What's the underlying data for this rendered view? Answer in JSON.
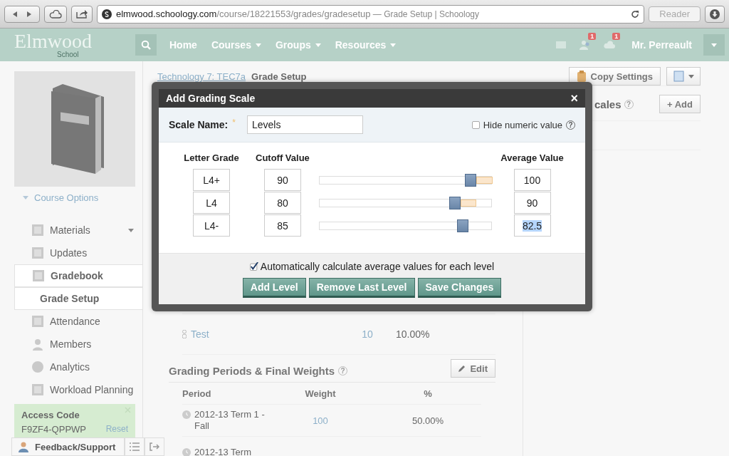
{
  "browser": {
    "url_host": "elmwood.schoology.com",
    "url_path": "/course/18221553/grades/gradesetup",
    "page_title": " — Grade Setup | Schoology",
    "reader": "Reader"
  },
  "nav": {
    "logo": "Elmwood",
    "logo_sub": "School",
    "items": [
      {
        "label": "Home",
        "dropdown": false
      },
      {
        "label": "Courses",
        "dropdown": true
      },
      {
        "label": "Groups",
        "dropdown": true
      },
      {
        "label": "Resources",
        "dropdown": true
      }
    ],
    "badges": [
      "1",
      "1"
    ],
    "user": "Mr. Perreault"
  },
  "sidebar": {
    "course_options": "Course Options",
    "items": [
      {
        "label": "Materials",
        "selected": false,
        "expandable": true
      },
      {
        "label": "Updates",
        "selected": false,
        "expandable": false
      },
      {
        "label": "Gradebook",
        "selected": true,
        "expandable": false,
        "children": [
          {
            "label": "Grade Setup",
            "selected": true
          }
        ]
      },
      {
        "label": "Attendance",
        "selected": false,
        "expandable": false
      },
      {
        "label": "Members",
        "selected": false,
        "expandable": false
      },
      {
        "label": "Analytics",
        "selected": false,
        "expandable": false
      },
      {
        "label": "Workload Planning",
        "selected": false,
        "expandable": false
      }
    ],
    "access_code": {
      "title": "Access Code",
      "code": "F9ZF4-QPPWP",
      "reset": "Reset"
    },
    "feedback": "Feedback/Support"
  },
  "breadcrumb": [
    {
      "label": "Technology 7: TEC7a",
      "link": true
    },
    {
      "label": "Grade Setup",
      "link": false
    }
  ],
  "toolbar": {
    "copy_settings": "Copy Settings"
  },
  "scales_section": {
    "title": "cales",
    "help": "?",
    "add": "+ Add"
  },
  "category_rows": [
    {
      "name": "Test",
      "weight": "10",
      "percent": "10.00%"
    }
  ],
  "grading_periods": {
    "title": "Grading Periods & Final Weights",
    "help": "?",
    "edit": "Edit",
    "columns": [
      "Period",
      "Weight",
      "%"
    ],
    "rows": [
      {
        "period": "2012-13 Term 1 - Fall",
        "weight": "100",
        "percent": "50.00%"
      },
      {
        "period": "2012-13 Term"
      }
    ]
  },
  "modal": {
    "title": "Add Grading Scale",
    "close": "×",
    "scale_name_label": "Scale Name:",
    "required_mark": "*",
    "scale_name": "Levels",
    "hide_numeric": {
      "label": "Hide numeric value",
      "help": "?",
      "checked": false
    },
    "columns": [
      "Letter Grade",
      "Cutoff Value",
      "Average Value"
    ],
    "levels": [
      {
        "grade": "L4+",
        "cutoff": "90",
        "level": 0.9,
        "average": "100",
        "text_selected": false
      },
      {
        "grade": "L4",
        "cutoff": "80",
        "level": 0.8,
        "average": "90",
        "text_selected": false
      },
      {
        "grade": "L4-",
        "cutoff": "85",
        "level": 0.85,
        "average": "82.5",
        "text_selected": true
      }
    ],
    "auto_calculate": {
      "label": "Automatically calculate average values for each level",
      "checked": true
    },
    "buttons": [
      "Add Level",
      "Remove Last Level",
      "Save Changes"
    ]
  }
}
